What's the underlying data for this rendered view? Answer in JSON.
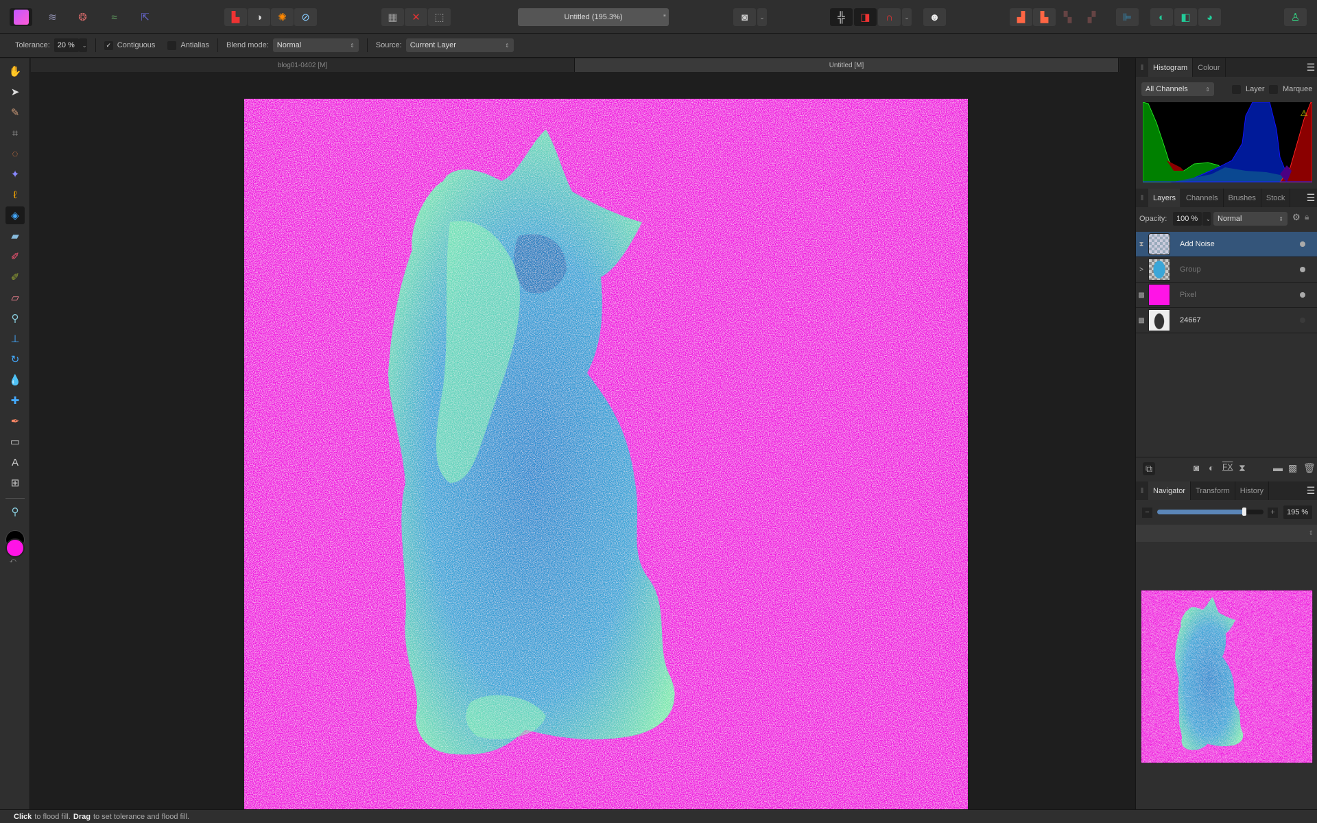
{
  "app": {
    "doc_title": "Untitled (195.3%)",
    "close_glyph": "*"
  },
  "toolbar": {
    "personas": [
      "photo-persona",
      "liquify-persona",
      "develop-persona",
      "tone-mapping-persona",
      "export-persona"
    ],
    "adjust": [
      "levels",
      "auto-contrast",
      "colour-wheel",
      "white-balance"
    ],
    "selection": [
      "select-all",
      "deselect",
      "invert-selection"
    ]
  },
  "context": {
    "tolerance_label": "Tolerance:",
    "tolerance_value": "20 %",
    "contiguous_label": "Contiguous",
    "contiguous_checked": true,
    "antialias_label": "Antialias",
    "antialias_checked": false,
    "blend_label": "Blend mode:",
    "blend_value": "Normal",
    "source_label": "Source:",
    "source_value": "Current Layer"
  },
  "tabs": [
    {
      "label": "blog01-0402 [M]",
      "active": false
    },
    {
      "label": "Untitled [M]",
      "active": true
    }
  ],
  "histogram": {
    "tabs": [
      "Histogram",
      "Colour"
    ],
    "channel": "All Channels",
    "layer_label": "Layer",
    "marquee_label": "Marquee"
  },
  "layers": {
    "tabs": [
      "Layers",
      "Channels",
      "Brushes",
      "Stock"
    ],
    "opacity_label": "Opacity:",
    "opacity_value": "100 %",
    "blend_value": "Normal",
    "items": [
      {
        "name": "Add Noise",
        "selected": true,
        "dim": false
      },
      {
        "name": "Group",
        "selected": false,
        "dim": true
      },
      {
        "name": "Pixel",
        "selected": false,
        "dim": true
      },
      {
        "name": "24667",
        "selected": false,
        "dim": false
      }
    ]
  },
  "navigator": {
    "tabs": [
      "Navigator",
      "Transform",
      "History"
    ],
    "zoom_value": "195 %",
    "zoom_fraction": 0.82
  },
  "colors": {
    "primary": "#ff14e6",
    "accent": "#34557a",
    "background": "#1e1e1e"
  },
  "status": {
    "click": "Click",
    "click_text": "to flood fill.",
    "drag": "Drag",
    "drag_text": "to set tolerance and flood fill."
  }
}
